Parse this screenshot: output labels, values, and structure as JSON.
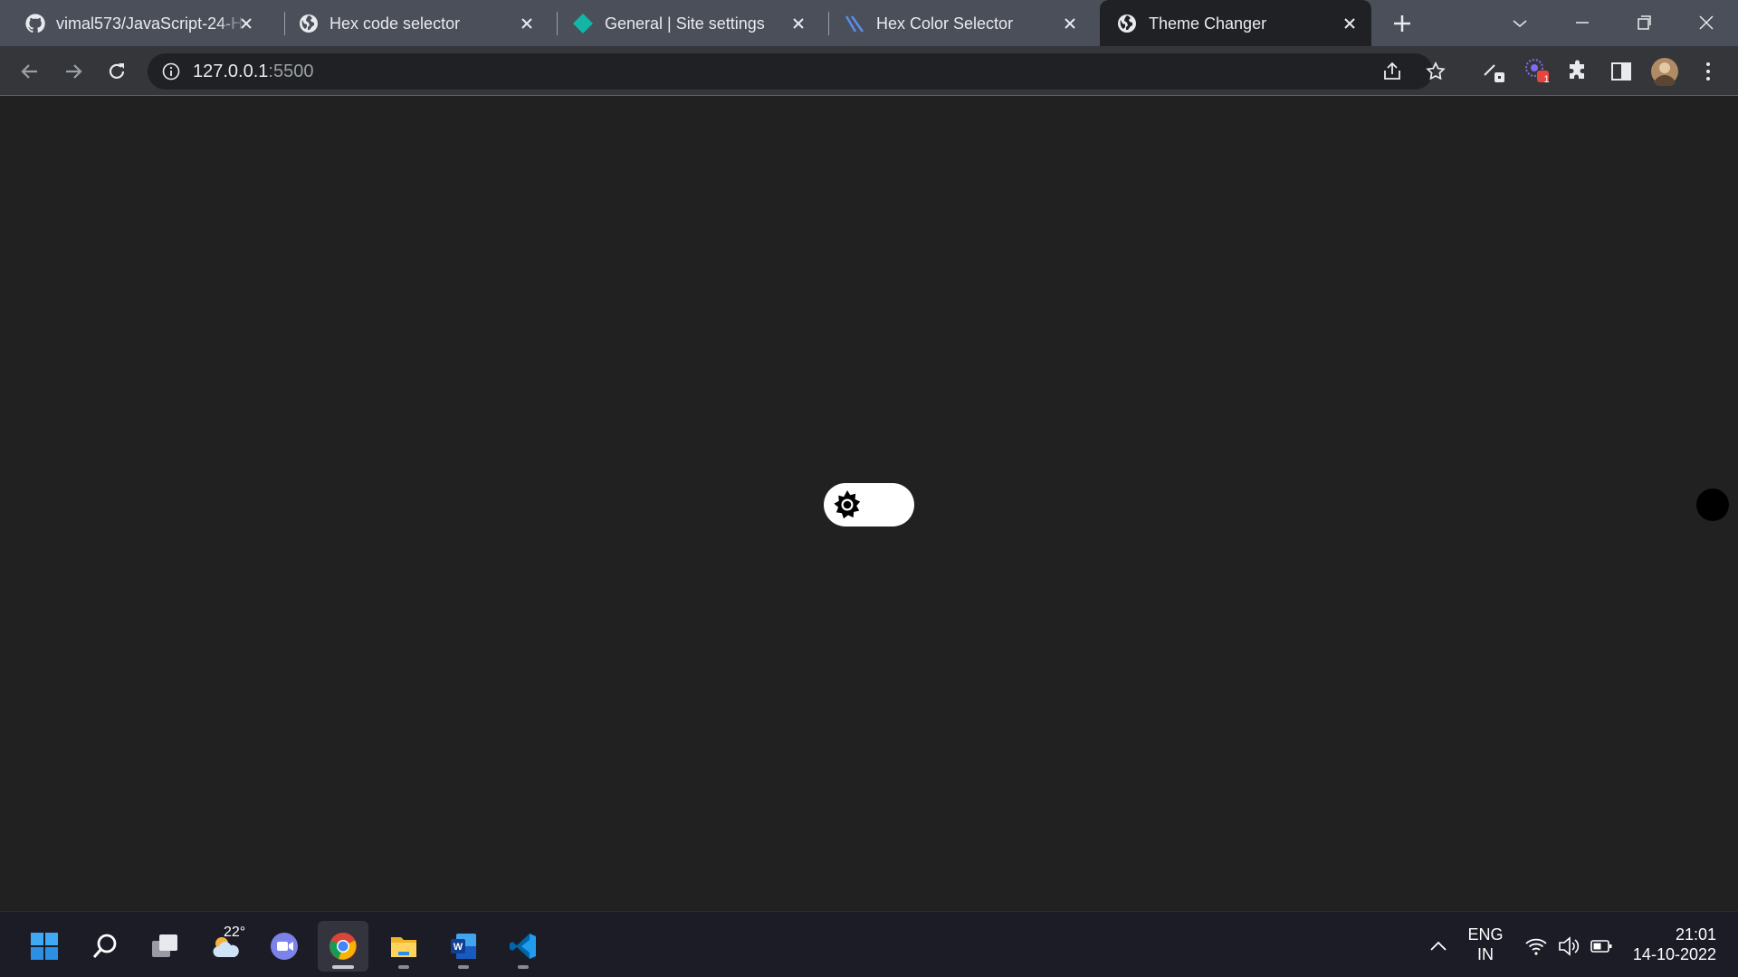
{
  "tabs": [
    {
      "title": "vimal573/JavaScript-24-H",
      "icon": "github-icon"
    },
    {
      "title": "Hex code selector",
      "icon": "globe-icon"
    },
    {
      "title": "General | Site settings",
      "icon": "diamond-icon"
    },
    {
      "title": "Hex Color Selector",
      "icon": "vscode-favicon-icon"
    },
    {
      "title": "Theme Changer",
      "icon": "globe-icon",
      "active": true
    }
  ],
  "address_bar": {
    "host": "127.0.0.1",
    "port": ":5500"
  },
  "extensions": {
    "badge_count": "1"
  },
  "page": {
    "theme": "dark",
    "toggle_state": "dark"
  },
  "colors": {
    "page_bg": "#212121",
    "tab_strip": "#4b4f59",
    "toolbar": "#35363a",
    "toggle_bg": "#ffffff"
  },
  "taskbar": {
    "weather_temp": "22°",
    "language_line1": "ENG",
    "language_line2": "IN",
    "time": "21:01",
    "date": "14-10-2022"
  }
}
